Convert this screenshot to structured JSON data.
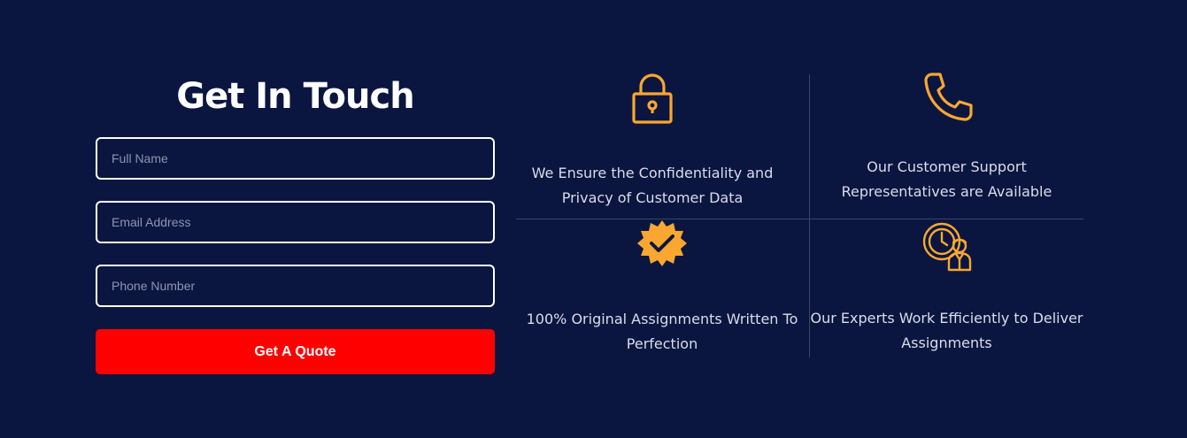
{
  "colors": {
    "background": "#0b1640",
    "accent": "#f9a731",
    "button": "#ff0000",
    "text": "#ffffff",
    "feature_text": "#d9dde8",
    "divider": "#3a4468"
  },
  "form": {
    "title": "Get In Touch",
    "full_name_placeholder": "Full Name",
    "email_placeholder": "Email Address",
    "phone_placeholder": "Phone Number",
    "submit_label": "Get A Quote"
  },
  "features": [
    {
      "icon": "padlock-icon",
      "text": "We Ensure the Confidentiality and Privacy of Customer Data"
    },
    {
      "icon": "phone-icon",
      "text": "Our Customer Support Representatives are Available"
    },
    {
      "icon": "checkmark-badge-icon",
      "text": "100% Original Assignments Written To Perfection"
    },
    {
      "icon": "expert-clock-icon",
      "text": "Our Experts Work Efficiently to Deliver Assignments"
    }
  ]
}
